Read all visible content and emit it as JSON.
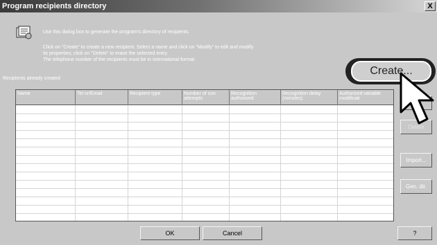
{
  "window": {
    "title": "Program recipients directory",
    "close_label": "X"
  },
  "info": {
    "line1": "Use this dialog box to generate the program's directory of recipients.",
    "line2": "Click on  \"Create\" to create a new recipient. Select a name and click on  \"Modify\" to edit and modify",
    "line3": "its properties; click on  \"Delete\" to erase the selected entry.",
    "line4": "The telephone number of the recipients must be in international format."
  },
  "table": {
    "label": "Recipients already created",
    "columns": [
      "Name",
      "Tel nr/Email",
      "Recipient type",
      "Number of con attempts",
      "Recognition authorized",
      "Recognition delay (minutes)",
      "Authorized variable modificati"
    ],
    "rows": []
  },
  "buttons": {
    "create": "Create...",
    "modify": "M",
    "delete": "Delete",
    "import": "Import...",
    "gen_dir": "Gen. dir.",
    "ok": "OK",
    "cancel": "Cancel",
    "help": "?"
  },
  "icons": {
    "info": "directory-icon",
    "cursor": "mouse-pointer-icon",
    "close": "close-icon"
  }
}
